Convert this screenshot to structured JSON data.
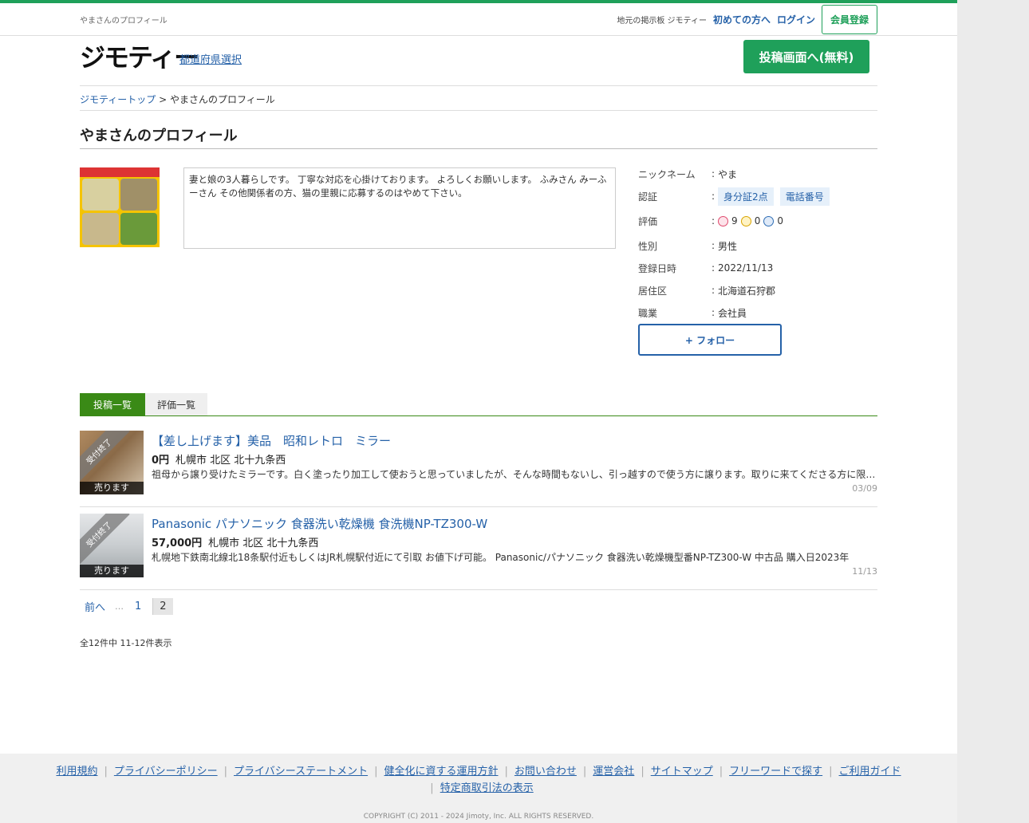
{
  "header": {
    "site_title": "やまさんのプロフィール",
    "links": {
      "board": "地元の掲示板 ジモティー",
      "first_time": "初めての方へ",
      "login": "ログイン",
      "register": "会員登録"
    },
    "logo": "ジモティー",
    "prefecture_link": "都道府県選択",
    "post_button": "投稿画面へ(無料)"
  },
  "breadcrumb": {
    "home": "ジモティートップ",
    "separator": ">",
    "current": "やまさんのプロフィール"
  },
  "page_title": "やまさんのプロフィール",
  "bio": "妻と娘の3人暮らしです。 丁寧な対応を心掛けております。 よろしくお願いします。 ふみさん みーふーさん その他関係者の方、猫の里親に応募するのはやめて下さい。",
  "profile": {
    "nickname_label": "ニックネーム",
    "nickname": "やま",
    "verify_label": "認証",
    "badge_id": "身分証2点",
    "badge_phone": "電話番号",
    "rating_label": "評価",
    "rating_good": "9",
    "rating_normal": "0",
    "rating_bad": "0",
    "gender_label": "性別",
    "gender": "男性",
    "registered_label": "登録日時",
    "registered": "2022/11/13",
    "area_label": "居住区",
    "area": "北海道石狩郡",
    "job_label": "職業",
    "job": "会社員",
    "colon": ":"
  },
  "follow_button": "+ フォロー",
  "tabs": [
    {
      "label": "投稿一覧"
    },
    {
      "label": "評価一覧"
    }
  ],
  "items": [
    {
      "title": "【差し上げます】美品　昭和レトロ　ミラー",
      "price": "0円",
      "location": "札幌市 北区 北十九条西",
      "description": "祖母から譲り受けたミラーです。白く塗ったり加工して使おうと思っていましたが、そんな時間もないし、引っ越すので使う方に譲ります。取りに来てくださる方に限ります。",
      "date": "03/09",
      "status": "受付終了",
      "category": "売ります",
      "thumb_color": "#8a6a48"
    },
    {
      "title": "Panasonic パナソニック 食器洗い乾燥機 食洗機NP-TZ300-W",
      "price": "57,000円",
      "location": "札幌市 北区 北十九条西",
      "description": "札幌地下鉄南北線北18条駅付近もしくはJR札幌駅付近にて引取 お値下げ可能。 Panasonic/パナソニック 食器洗い乾燥機型番NP-TZ300-W 中古品 購入日2023年",
      "date": "11/13",
      "status": "受付終了",
      "category": "売ります",
      "thumb_color": "#c9cdd0"
    }
  ],
  "pager": {
    "prev": "前へ",
    "dots": "…",
    "page1": "1",
    "current": "2"
  },
  "count_text": "全12件中 11-12件表示",
  "footer": {
    "links": [
      "利用規約",
      "プライバシーポリシー",
      "プライバシーステートメント",
      "健全化に資する運用方針",
      "お問い合わせ",
      "運営会社",
      "サイトマップ",
      "フリーワードで探す",
      "ご利用ガイド"
    ],
    "link_second_line": "特定商取引法の表示",
    "copyright": "COPYRIGHT (C) 2011 - 2024 Jimoty, Inc. ALL RIGHTS RESERVED."
  },
  "colors": {
    "brand_green": "#1fa05a",
    "tab_green": "#3a8a16",
    "link_blue": "#2561a8"
  }
}
